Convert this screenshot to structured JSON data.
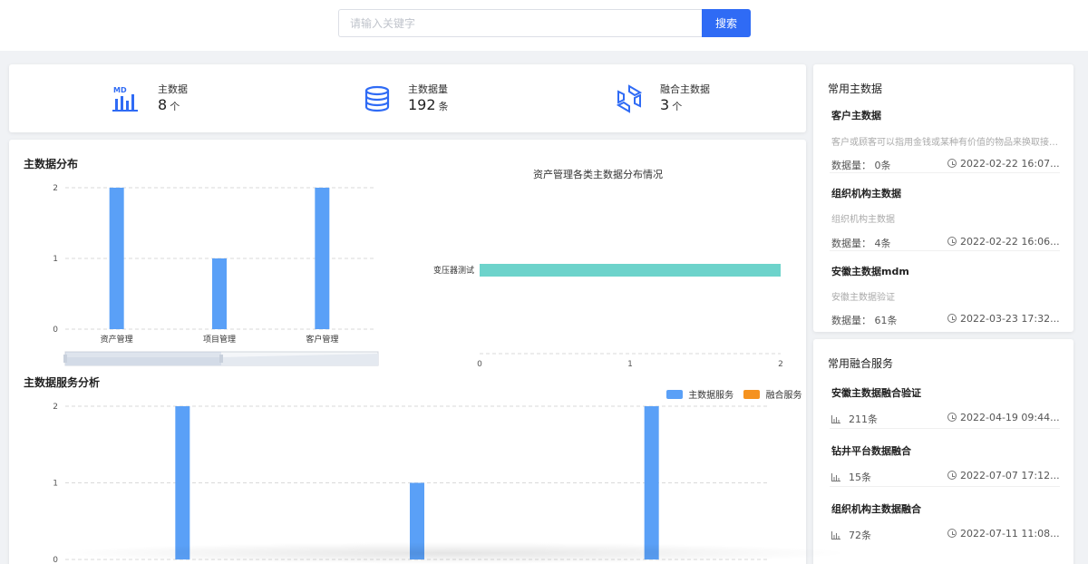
{
  "search": {
    "placeholder": "请输入关键字",
    "button": "搜索"
  },
  "stats": [
    {
      "label": "主数据",
      "value": "8",
      "unit": "个",
      "icon": "md-chart-icon"
    },
    {
      "label": "主数据量",
      "value": "192",
      "unit": "条",
      "icon": "database-icon"
    },
    {
      "label": "融合主数据",
      "value": "3",
      "unit": "个",
      "icon": "fusion-icon"
    }
  ],
  "distribution": {
    "title": "主数据分布"
  },
  "asset_chart": {
    "title": "资产管理各类主数据分布情况"
  },
  "service": {
    "title": "主数据服务分析",
    "legend": [
      {
        "name": "主数据服务",
        "color": "#5aa0f7"
      },
      {
        "name": "融合服务",
        "color": "#f5921f"
      }
    ]
  },
  "chart_data": [
    {
      "type": "bar",
      "title": "主数据分布",
      "categories": [
        "资产管理",
        "项目管理",
        "客户管理"
      ],
      "values": [
        2,
        1,
        2
      ],
      "ylim": [
        0,
        2
      ],
      "yticks": [
        "0",
        "1",
        "2"
      ],
      "grid": true,
      "color": "#5aa0f7"
    },
    {
      "type": "bar",
      "orientation": "horizontal",
      "title": "资产管理各类主数据分布情况",
      "categories": [
        "变压器测试"
      ],
      "values": [
        2
      ],
      "xlim": [
        0,
        2
      ],
      "xticks": [
        "0",
        "1",
        "2"
      ],
      "color": "#6dd3cb"
    },
    {
      "type": "bar",
      "title": "主数据服务分析",
      "series": [
        {
          "name": "主数据服务",
          "values": [
            2,
            1,
            2
          ]
        },
        {
          "name": "融合服务",
          "values": [
            0,
            0,
            0
          ]
        }
      ],
      "ylim": [
        0,
        2
      ],
      "yticks": [
        "0",
        "1",
        "2"
      ],
      "grid": true,
      "legend": "top-right"
    }
  ],
  "common_md": {
    "title": "常用主数据",
    "items": [
      {
        "name": "客户主数据",
        "desc": "客户或顾客可以指用金钱或某种有价值的物品来换取接受财产、服务、产品或某种创意的自然人或组织",
        "count_label": "数据量：",
        "count": "0条",
        "time": "2022-02-22 16:07..."
      },
      {
        "name": "组织机构主数据",
        "desc": "组织机构主数据",
        "count_label": "数据量：",
        "count": "4条",
        "time": "2022-02-22 16:06..."
      },
      {
        "name": "安徽主数据mdm",
        "desc": "安徽主数据验证",
        "count_label": "数据量：",
        "count": "61条",
        "time": "2022-03-23 17:32..."
      }
    ]
  },
  "fusion": {
    "title": "常用融合服务",
    "items": [
      {
        "name": "安徽主数据融合验证",
        "count": "211条",
        "time": "2022-04-19 09:44..."
      },
      {
        "name": "钻井平台数据融合",
        "count": "15条",
        "time": "2022-07-07 17:12..."
      },
      {
        "name": "组织机构主数据融合",
        "count": "72条",
        "time": "2022-07-11 11:08..."
      }
    ]
  }
}
